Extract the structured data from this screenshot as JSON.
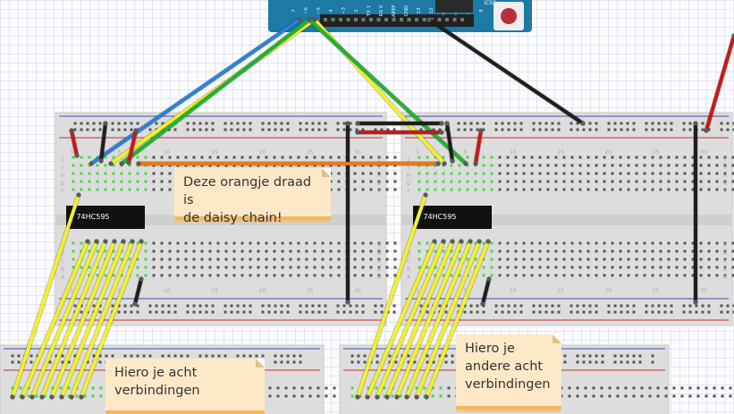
{
  "arduino": {
    "header_left_labels": [
      "AREF",
      "GND",
      "13",
      "12",
      "~11",
      "~10",
      "~9",
      "8"
    ],
    "header_right_labels": [
      "7",
      "~6",
      "~5",
      "4",
      "~3",
      "2",
      "TX 1",
      "RX 0"
    ],
    "chip_text": "ICSP",
    "board_color": "#1c7aa5"
  },
  "chips": [
    {
      "label": "74HC595"
    },
    {
      "label": "74HC595"
    }
  ],
  "breadboard": {
    "column_numbers": [
      "1",
      "5",
      "10",
      "15",
      "20",
      "25",
      "30"
    ],
    "row_letters_top": [
      "J",
      "I",
      "H",
      "G",
      "F"
    ],
    "row_letters_bottom": [
      "E",
      "D",
      "C",
      "B",
      "A"
    ]
  },
  "notes": [
    {
      "text": "Deze orangje draad is\nde daisy chain!"
    },
    {
      "text": "Hiero je acht\nverbindingen"
    },
    {
      "text": "Hiero je\nandere acht\nverbindingen"
    }
  ],
  "colors": {
    "wire_blue": "#2f7fd6",
    "wire_yellow": "#f3f02a",
    "wire_green": "#22b133",
    "wire_black": "#1e1e1e",
    "wire_red": "#c81818",
    "wire_orange": "#e07a1e",
    "hole_green": "#4cd64a",
    "board_gray": "#dcdcdc"
  }
}
